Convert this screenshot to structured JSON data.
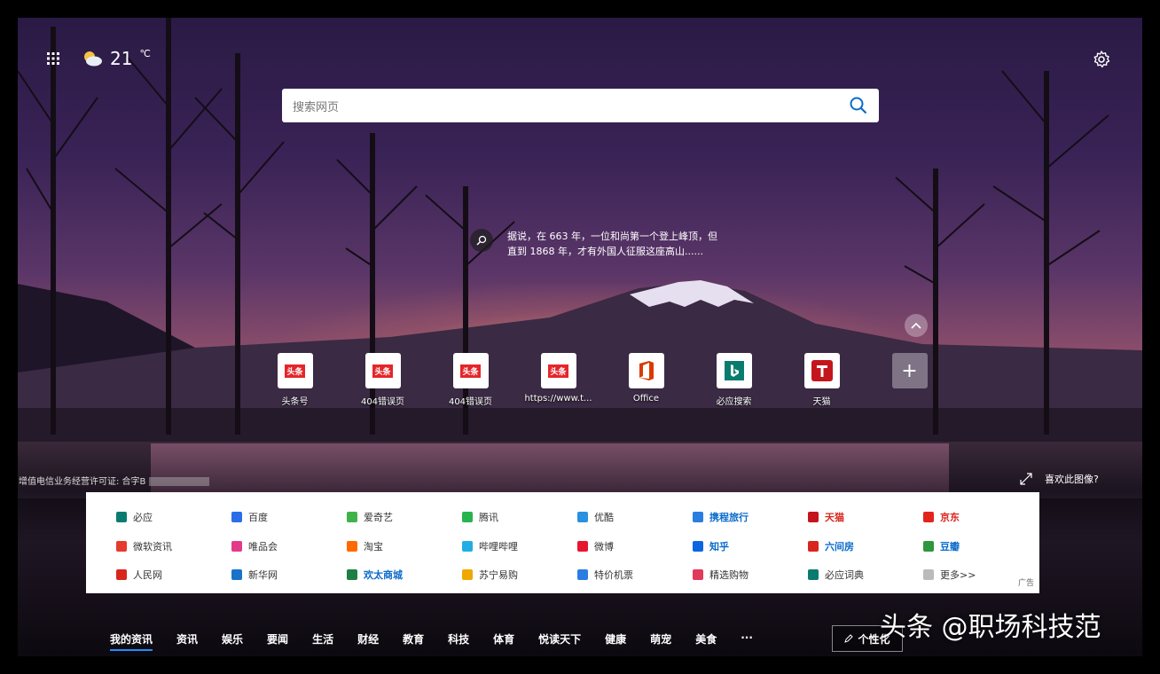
{
  "weather": {
    "temp": "21",
    "unit": "℃"
  },
  "search": {
    "placeholder": "搜索网页"
  },
  "fact": {
    "text": "据说，在 663 年，一位和尚第一个登上峰顶，但直到 1868 年，才有外国人征服这座高山......"
  },
  "quick_links": [
    {
      "label": "头条号",
      "icon": "toutiao-icon"
    },
    {
      "label": "404错误页",
      "icon": "toutiao-icon"
    },
    {
      "label": "404错误页",
      "icon": "toutiao-icon"
    },
    {
      "label": "https://www.t...",
      "icon": "toutiao-icon"
    },
    {
      "label": "Office",
      "icon": "office-icon"
    },
    {
      "label": "必应搜索",
      "icon": "bing-icon"
    },
    {
      "label": "天猫",
      "icon": "tmall-icon"
    }
  ],
  "license": "增值电信业务经营许可证: 合字B",
  "like_image": "喜欢此图像?",
  "site_links": [
    {
      "label": "必应",
      "color": "#0a7c6f",
      "style": "normal"
    },
    {
      "label": "百度",
      "color": "#2a6ee8",
      "style": "normal"
    },
    {
      "label": "爱奇艺",
      "color": "#3fb34a",
      "style": "normal"
    },
    {
      "label": "腾讯",
      "color": "#27b34e",
      "style": "normal"
    },
    {
      "label": "优酷",
      "color": "#2a90e0",
      "style": "normal"
    },
    {
      "label": "携程旅行",
      "color": "#2a7de1",
      "style": "blue"
    },
    {
      "label": "天猫",
      "color": "#c4151c",
      "style": "red"
    },
    {
      "label": "京东",
      "color": "#e1251b",
      "style": "red"
    },
    {
      "label": "微软资讯",
      "color": "#e63a2d",
      "style": "normal"
    },
    {
      "label": "唯品会",
      "color": "#e23a8a",
      "style": "normal"
    },
    {
      "label": "淘宝",
      "color": "#ff6a00",
      "style": "normal"
    },
    {
      "label": "哔哩哔哩",
      "color": "#23ade5",
      "style": "normal"
    },
    {
      "label": "微博",
      "color": "#e6162d",
      "style": "normal"
    },
    {
      "label": "知乎",
      "color": "#0a66e0",
      "style": "blue"
    },
    {
      "label": "六间房",
      "color": "#d8261c",
      "style": "blue"
    },
    {
      "label": "豆瓣",
      "color": "#2e963d",
      "style": "blue"
    },
    {
      "label": "人民网",
      "color": "#d8261c",
      "style": "normal"
    },
    {
      "label": "新华网",
      "color": "#1a73c9",
      "style": "normal"
    },
    {
      "label": "欢太商城",
      "color": "#1e7f46",
      "style": "blue"
    },
    {
      "label": "苏宁易购",
      "color": "#f0a800",
      "style": "normal"
    },
    {
      "label": "特价机票",
      "color": "#2a7de1",
      "style": "normal"
    },
    {
      "label": "精选购物",
      "color": "#e23a5a",
      "style": "normal"
    },
    {
      "label": "必应词典",
      "color": "#0a7c6f",
      "style": "normal"
    },
    {
      "label": "更多>>",
      "color": "#bbbbbb",
      "style": "normal"
    }
  ],
  "ad_label": "广告",
  "news_tabs": [
    "我的资讯",
    "资讯",
    "娱乐",
    "要闻",
    "生活",
    "财经",
    "教育",
    "科技",
    "体育",
    "悦读天下",
    "健康",
    "萌宠",
    "美食",
    "···"
  ],
  "personalize": "个性化",
  "watermark": "头条 @职场科技范"
}
